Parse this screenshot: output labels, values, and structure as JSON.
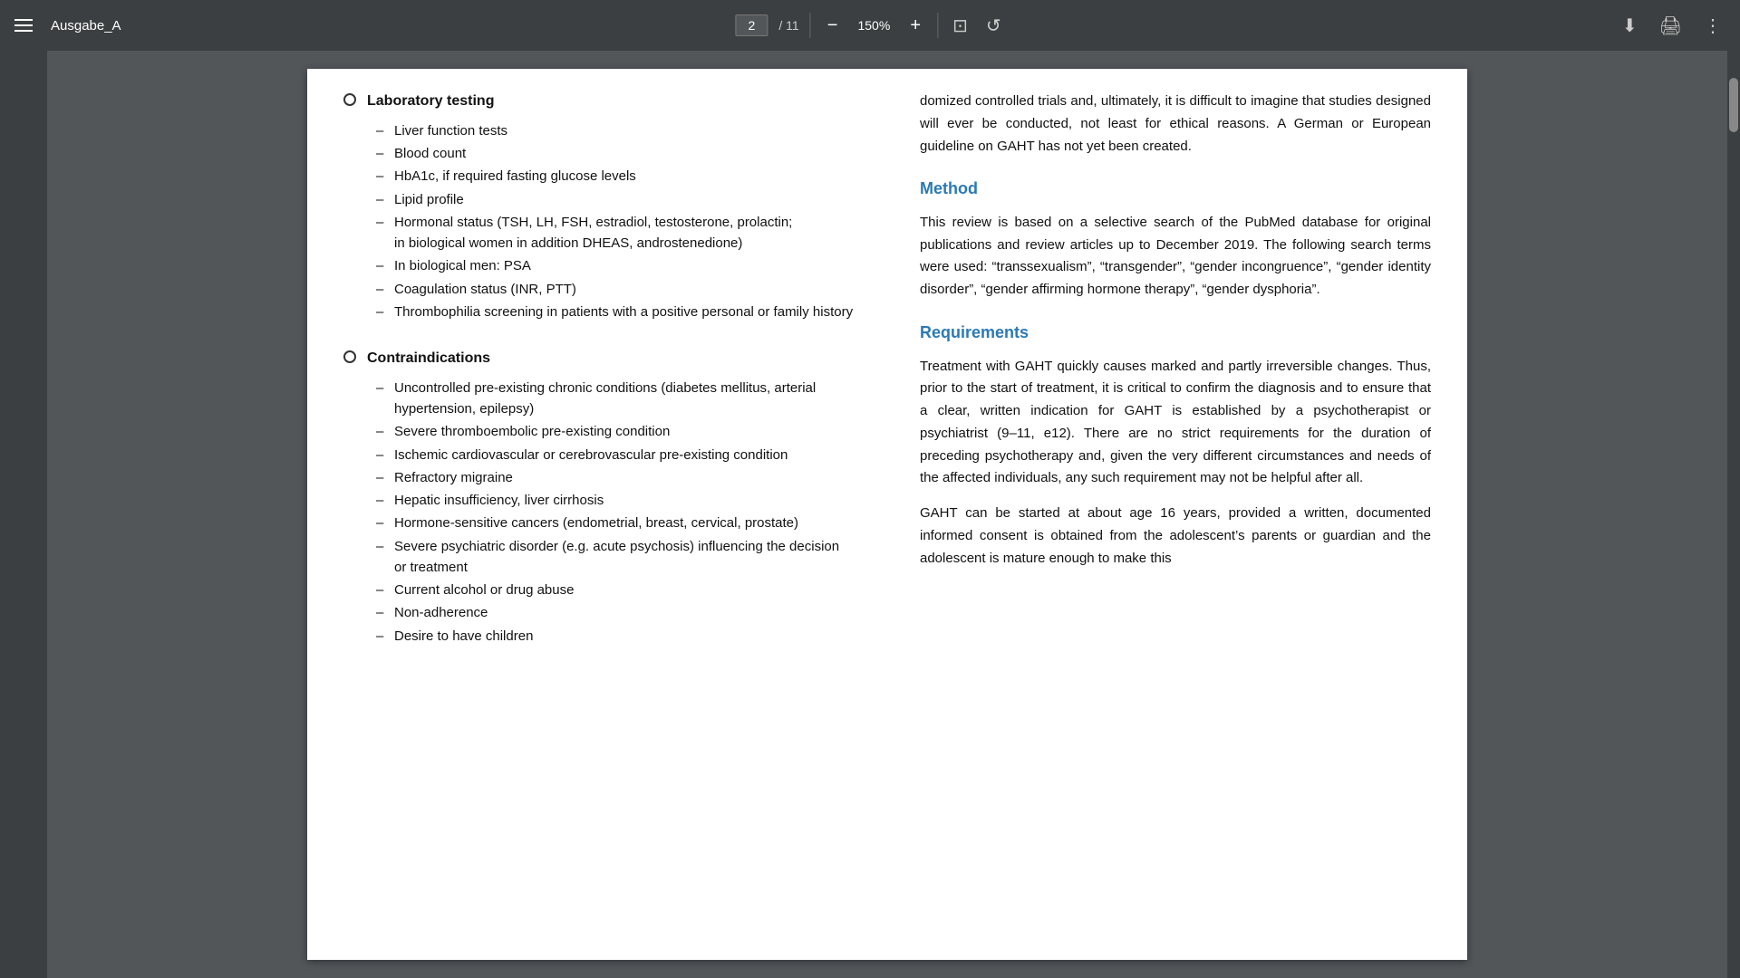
{
  "toolbar": {
    "menu_label": "Menu",
    "filename": "Ausgabe_A",
    "current_page": "2",
    "total_pages": "11",
    "zoom": "150%",
    "zoom_label": "150%",
    "download_label": "Download",
    "print_label": "Print",
    "more_label": "More options"
  },
  "left_col": {
    "section1": {
      "header": "Laboratory testing",
      "items": [
        "Liver function tests",
        "Blood count",
        "HbA1c, if required fasting glucose levels",
        "Lipid profile",
        "Hormonal status (TSH, LH, FSH, estradiol, testosterone, prolactin; in biological women in addition DHEAS, androstenedione)",
        "In biological men: PSA",
        "Coagulation status (INR, PTT)",
        "Thrombophilia screening in patients with a positive personal or family history"
      ]
    },
    "section2": {
      "header": "Contraindications",
      "items": [
        "Uncontrolled pre-existing chronic conditions (diabetes mellitus, arterial hypertension, epilepsy)",
        "Severe thromboembolic pre-existing condition",
        "Ischemic cardiovascular or cerebrovascular pre-existing condition",
        "Refractory migraine",
        "Hepatic insufficiency, liver cirrhosis",
        "Hormone-sensitive cancers (endometrial, breast, cervical, prostate)",
        "Severe psychiatric disorder (e.g. acute psychosis) influencing the decision or treatment",
        "Current alcohol or drug abuse",
        "Non-adherence",
        "Desire to have children"
      ]
    }
  },
  "right_col": {
    "intro_text": "domized controlled trials and, ultimately, it is difficult to imagine that studies designed will ever be conducted, not least for ethical reasons. A German or European guideline on GAHT has not yet been created.",
    "method": {
      "heading": "Method",
      "text": "This review is based on a selective search of the PubMed database for original publications and review articles up to December 2019. The following search terms were used: “transsexualism”, “transgender”, “gender incongruence”, “gender identity disorder”, “gender affirming hormone therapy”, “gender dysphoria”."
    },
    "requirements": {
      "heading": "Requirements",
      "para1": "Treatment with GAHT quickly causes marked and partly irreversible changes. Thus, prior to the start of treatment, it is critical to confirm the diagnosis and to ensure that a clear, written indication for GAHT is established by a psychotherapist or psychiatrist (9–11, e12). There are no strict requirements for the duration of preceding psychotherapy and, given the very different circumstances and needs of the affected individuals, any such requirement may not be helpful after all.",
      "para2": "GAHT can be started at about age 16 years, provided a written, documented informed consent is obtained from the adolescent’s parents or guardian and the adolescent is mature enough to make this"
    }
  }
}
